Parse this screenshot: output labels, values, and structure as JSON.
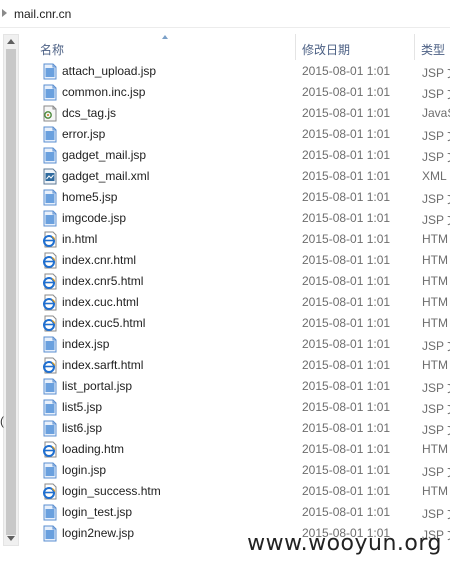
{
  "breadcrumb": {
    "path": "mail.cnr.cn"
  },
  "columns": {
    "name": "名称",
    "date": "修改日期",
    "type": "类型"
  },
  "colors": {
    "header_text": "#4d6185",
    "jsp_icon": "#5b8fd0",
    "html_icon": "#1f6fd0"
  },
  "files": [
    {
      "name": "attach_upload.jsp",
      "date": "2015-08-01 1:01",
      "type": "JSP 文",
      "icon": "jsp-file-icon"
    },
    {
      "name": "common.inc.jsp",
      "date": "2015-08-01 1:01",
      "type": "JSP 文",
      "icon": "jsp-file-icon"
    },
    {
      "name": "dcs_tag.js",
      "date": "2015-08-01 1:01",
      "type": "JavaS",
      "icon": "js-file-icon"
    },
    {
      "name": "error.jsp",
      "date": "2015-08-01 1:01",
      "type": "JSP 文",
      "icon": "jsp-file-icon"
    },
    {
      "name": "gadget_mail.jsp",
      "date": "2015-08-01 1:01",
      "type": "JSP 文",
      "icon": "jsp-file-icon"
    },
    {
      "name": "gadget_mail.xml",
      "date": "2015-08-01 1:01",
      "type": "XML",
      "icon": "xml-file-icon"
    },
    {
      "name": "home5.jsp",
      "date": "2015-08-01 1:01",
      "type": "JSP 文",
      "icon": "jsp-file-icon"
    },
    {
      "name": "imgcode.jsp",
      "date": "2015-08-01 1:01",
      "type": "JSP 文",
      "icon": "jsp-file-icon"
    },
    {
      "name": "in.html",
      "date": "2015-08-01 1:01",
      "type": "HTM",
      "icon": "html-file-icon"
    },
    {
      "name": "index.cnr.html",
      "date": "2015-08-01 1:01",
      "type": "HTM",
      "icon": "html-file-icon"
    },
    {
      "name": "index.cnr5.html",
      "date": "2015-08-01 1:01",
      "type": "HTM",
      "icon": "html-file-icon"
    },
    {
      "name": "index.cuc.html",
      "date": "2015-08-01 1:01",
      "type": "HTM",
      "icon": "html-file-icon"
    },
    {
      "name": "index.cuc5.html",
      "date": "2015-08-01 1:01",
      "type": "HTM",
      "icon": "html-file-icon"
    },
    {
      "name": "index.jsp",
      "date": "2015-08-01 1:01",
      "type": "JSP 文",
      "icon": "jsp-file-icon"
    },
    {
      "name": "index.sarft.html",
      "date": "2015-08-01 1:01",
      "type": "HTM",
      "icon": "html-file-icon"
    },
    {
      "name": "list_portal.jsp",
      "date": "2015-08-01 1:01",
      "type": "JSP 文",
      "icon": "jsp-file-icon"
    },
    {
      "name": "list5.jsp",
      "date": "2015-08-01 1:01",
      "type": "JSP 文",
      "icon": "jsp-file-icon"
    },
    {
      "name": "list6.jsp",
      "date": "2015-08-01 1:01",
      "type": "JSP 文",
      "icon": "jsp-file-icon"
    },
    {
      "name": "loading.htm",
      "date": "2015-08-01 1:01",
      "type": "HTM",
      "icon": "html-file-icon"
    },
    {
      "name": "login.jsp",
      "date": "2015-08-01 1:01",
      "type": "JSP 文",
      "icon": "jsp-file-icon"
    },
    {
      "name": "login_success.htm",
      "date": "2015-08-01 1:01",
      "type": "HTM",
      "icon": "html-file-icon"
    },
    {
      "name": "login_test.jsp",
      "date": "2015-08-01 1:01",
      "type": "JSP 文",
      "icon": "jsp-file-icon"
    },
    {
      "name": "login2new.jsp",
      "date": "2015-08-01 1:01",
      "type": "JSP 文",
      "icon": "jsp-file-icon"
    }
  ],
  "left_edge_text": "(",
  "watermark": "www.wooyun.org"
}
